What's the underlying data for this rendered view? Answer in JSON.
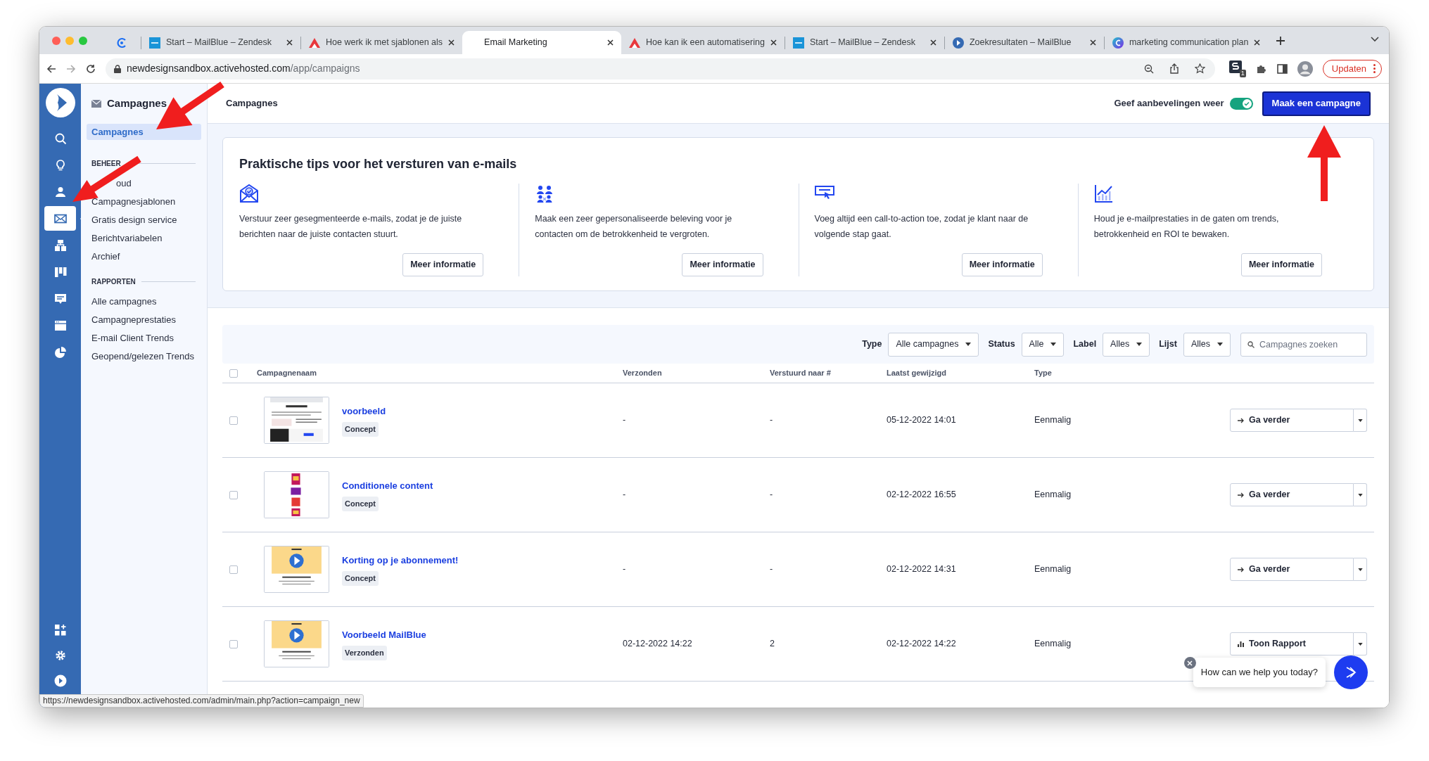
{
  "browser": {
    "tabs": [
      {
        "selected": false
      },
      {
        "title": "Start – MailBlue – Zendesk",
        "selected": false
      },
      {
        "title": "Hoe werk ik met sjablonen als",
        "selected": false
      },
      {
        "title": "Email Marketing",
        "selected": true
      },
      {
        "title": "Hoe kan ik een automatisering",
        "selected": false
      },
      {
        "title": "Start – MailBlue – Zendesk",
        "selected": false
      },
      {
        "title": "Zoekresultaten – MailBlue",
        "selected": false
      },
      {
        "title": "marketing communication plan",
        "selected": false
      }
    ],
    "url_host": "newdesignsandbox.activehosted.com",
    "url_path": "/app/campaigns",
    "extension_badge": "1",
    "update_button": "Updaten"
  },
  "rail": {
    "items": [
      {
        "selected": false
      },
      {
        "selected": false
      },
      {
        "selected": false
      },
      {
        "selected": true
      },
      {
        "selected": false
      },
      {
        "selected": false
      },
      {
        "selected": false
      },
      {
        "selected": false
      },
      {
        "selected": false
      }
    ],
    "bottom": [
      {
        "selected": false
      },
      {
        "selected": false
      },
      {
        "selected": false
      }
    ]
  },
  "sidebar": {
    "title": "Campagnes",
    "items": [
      {
        "label": "Campagnes",
        "selected": true
      }
    ],
    "sections": [
      {
        "heading": "BEHEER",
        "items": [
          {
            "label": "oud",
            "selected": false
          },
          {
            "label": "Campagnesjablonen",
            "selected": false
          },
          {
            "label": "Gratis design service",
            "selected": false
          },
          {
            "label": "Berichtvariabelen",
            "selected": false
          },
          {
            "label": "Archief",
            "selected": false
          }
        ]
      },
      {
        "heading": "RAPPORTEN",
        "items": [
          {
            "label": "Alle campagnes",
            "selected": false
          },
          {
            "label": "Campagneprestaties",
            "selected": false
          },
          {
            "label": "E-mail Client Trends",
            "selected": false
          },
          {
            "label": "Geopend/gelezen Trends",
            "selected": false
          }
        ]
      }
    ]
  },
  "header": {
    "title": "Campagnes",
    "recommendations_label": "Geef aanbevelingen weer",
    "recommendations_on": true,
    "create_button": "Maak een campagne"
  },
  "tips": {
    "title": "Praktische tips voor het versturen van e-mails",
    "items": [
      {
        "text": "Verstuur zeer gesegmenteerde e-mails, zodat je de juiste berichten naar de juiste contacten stuurt.",
        "button": "Meer informatie"
      },
      {
        "text": "Maak een zeer gepersonaliseerde beleving voor je contacten om de betrokkenheid te vergroten.",
        "button": "Meer informatie"
      },
      {
        "text": "Voeg altijd een call-to-action toe, zodat je klant naar de volgende stap gaat.",
        "button": "Meer informatie"
      },
      {
        "text": "Houd je e-mailprestaties in de gaten om trends, betrokkenheid en ROI te bewaken.",
        "button": "Meer informatie"
      }
    ]
  },
  "filters": [
    {
      "label": "Type",
      "value": "Alle campagnes"
    },
    {
      "label": "Status",
      "value": "Alle"
    },
    {
      "label": "Label",
      "value": "Alles"
    },
    {
      "label": "Lijst",
      "value": "Alles"
    }
  ],
  "search": {
    "placeholder": "Campagnes zoeken"
  },
  "table": {
    "select_all_checked": false,
    "columns": [
      "Campagnenaam",
      "Verzonden",
      "Verstuurd naar #",
      "Laatst gewijzigd",
      "Type"
    ],
    "rows": [
      {
        "checked": false,
        "name": "voorbeeld",
        "status": "Concept",
        "sent": "-",
        "sent_to": "-",
        "modified": "05-12-2022 14:01",
        "type": "Eenmalig",
        "kind": "continue",
        "action": "Ga verder"
      },
      {
        "checked": false,
        "name": "Conditionele content",
        "status": "Concept",
        "sent": "-",
        "sent_to": "-",
        "modified": "02-12-2022 16:55",
        "type": "Eenmalig",
        "kind": "continue",
        "action": "Ga verder"
      },
      {
        "checked": false,
        "name": "Korting op je abonnement!",
        "status": "Concept",
        "sent": "-",
        "sent_to": "-",
        "modified": "02-12-2022 14:31",
        "type": "Eenmalig",
        "kind": "continue",
        "action": "Ga verder"
      },
      {
        "checked": false,
        "name": "Voorbeeld MailBlue",
        "status": "Verzonden",
        "sent": "02-12-2022 14:22",
        "sent_to": "2",
        "modified": "02-12-2022 14:22",
        "type": "Eenmalig",
        "kind": "report",
        "action": "Toon Rapport"
      }
    ]
  },
  "status_url": "https://newdesignsandbox.activehosted.com/admin/main.php?action=campaign_new",
  "chat": {
    "message": "How can we help you today?"
  }
}
